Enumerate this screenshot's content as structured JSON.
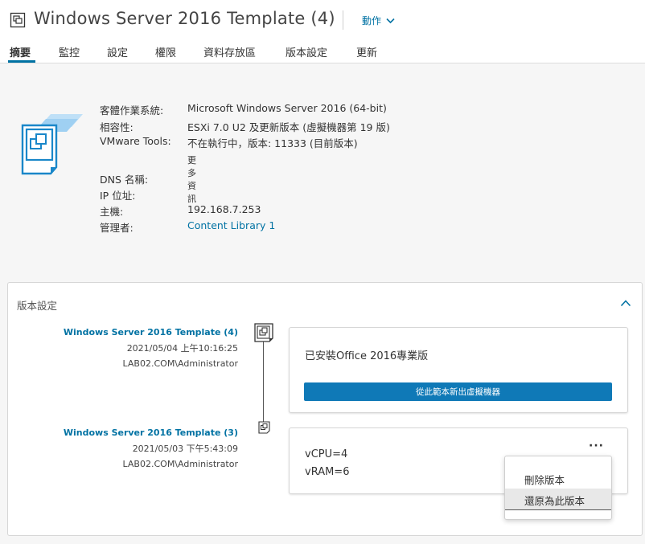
{
  "header": {
    "title": "Windows Server 2016 Template (4)",
    "actions_label": "動作"
  },
  "tabs": [
    {
      "label": "摘要",
      "active": true
    },
    {
      "label": "監控"
    },
    {
      "label": "設定"
    },
    {
      "label": "權限"
    },
    {
      "label": "資料存放區"
    },
    {
      "label": "版本設定"
    },
    {
      "label": "更新"
    }
  ],
  "summary": {
    "guest_os_label": "客體作業系統:",
    "guest_os_value": "Microsoft Windows Server 2016 (64-bit)",
    "compat_label": "相容性:",
    "compat_value": "ESXi 7.0 U2 及更新版本 (虛擬機器第 19 版)",
    "tools_label": "VMware Tools:",
    "tools_value": "不在執行中，版本: 11333 (目前版本)",
    "more_info": "更多資訊",
    "dns_label": "DNS 名稱:",
    "ip_label": "IP 位址:",
    "host_label": "主機:",
    "host_value": "192.168.7.253",
    "managed_label": "管理者:",
    "managed_value": "Content Library 1"
  },
  "versioning": {
    "title": "版本設定",
    "versions": [
      {
        "name": "Windows Server 2016 Template (4)",
        "date": "2021/05/04 上午10:16:25",
        "user": "LAB02.COM\\Administrator",
        "notes": "已安裝Office 2016專業版",
        "deploy_label": "從此範本新出虛擬機器"
      },
      {
        "name": "Windows Server 2016 Template (3)",
        "date": "2021/05/03 下午5:43:09",
        "user": "LAB02.COM\\Administrator",
        "notes_line1": "vCPU=4",
        "notes_line2": "vRAM=6"
      }
    ],
    "menu": {
      "delete_label": "刪除版本",
      "revert_label": "還原為此版本"
    }
  },
  "colors": {
    "accent": "#0072a3",
    "button": "#0f79b7"
  }
}
